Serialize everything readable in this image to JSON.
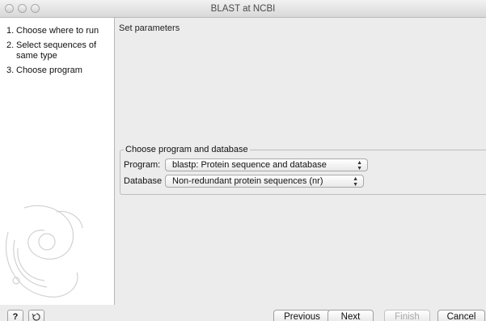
{
  "window": {
    "title": "BLAST at NCBI"
  },
  "sidebar": {
    "steps": [
      {
        "num": "1.",
        "label": "Choose where to run"
      },
      {
        "num": "2.",
        "label": "Select sequences of same type"
      },
      {
        "num": "3.",
        "label": "Choose program"
      }
    ]
  },
  "main": {
    "section_title": "Set parameters",
    "group": {
      "title": "Choose program and database",
      "program_label": "Program:",
      "program_value": "blastp: Protein sequence and database",
      "database_label": "Database",
      "database_value": "Non-redundant protein sequences (nr)"
    }
  },
  "footer": {
    "help_label": "?",
    "previous_label": "Previous",
    "next_label": "Next",
    "finish_label": "Finish",
    "cancel_label": "Cancel"
  },
  "icons": {
    "help": "help-icon",
    "reset": "reset-icon",
    "select_arrows": "up-down-arrows-icon"
  }
}
